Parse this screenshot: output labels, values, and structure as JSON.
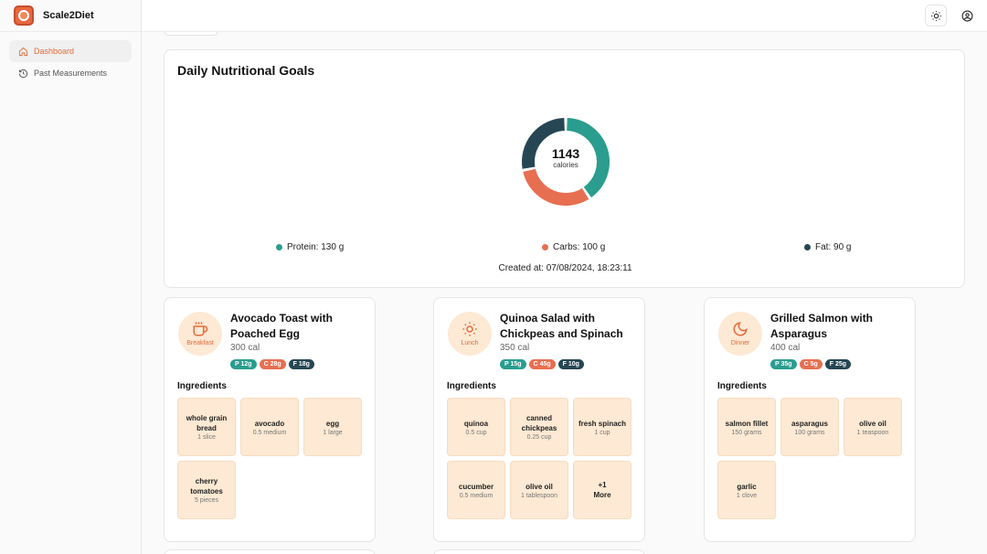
{
  "app": {
    "name": "Scale2Diet"
  },
  "sidebar": {
    "items": [
      {
        "label": "Dashboard",
        "active": true
      },
      {
        "label": "Past Measurements",
        "active": false
      }
    ]
  },
  "goals": {
    "title": "Daily Nutritional Goals",
    "calories": "1143",
    "calories_label": "calories",
    "protein": "Protein: 130 g",
    "carbs": "Carbs: 100 g",
    "fat": "Fat: 90 g",
    "created": "Created at: 07/08/2024, 18:23:11"
  },
  "chart_data": {
    "type": "pie",
    "categories": [
      "Protein",
      "Carbs",
      "Fat"
    ],
    "values": [
      130,
      100,
      90
    ],
    "colors": [
      "#2a9d8f",
      "#e76f51",
      "#264653"
    ]
  },
  "colors": {
    "accent": "#e46a3a",
    "protein": "#2a9d8f",
    "carbs": "#e76f51",
    "fat": "#264653",
    "ingredient_bg": "#fde9d4"
  },
  "ingredients_label": "Ingredients",
  "meals": [
    {
      "type": "Breakfast",
      "icon": "coffee-icon",
      "name": "Avocado Toast with Poached Egg",
      "calories": "300 cal",
      "protein": "P 12g",
      "carbs": "C 28g",
      "fat": "F 18g",
      "ingredients": [
        {
          "name": "whole grain bread",
          "qty": "1 slice"
        },
        {
          "name": "avocado",
          "qty": "0.5 medium"
        },
        {
          "name": "egg",
          "qty": "1 large"
        },
        {
          "name": "cherry tomatoes",
          "qty": "5 pieces"
        }
      ]
    },
    {
      "type": "Lunch",
      "icon": "sun-icon",
      "name": "Quinoa Salad with Chickpeas and Spinach",
      "calories": "350 cal",
      "protein": "P 15g",
      "carbs": "C 45g",
      "fat": "F 10g",
      "ingredients": [
        {
          "name": "quinoa",
          "qty": "0.5 cup"
        },
        {
          "name": "canned chickpeas",
          "qty": "0.25 cup"
        },
        {
          "name": "fresh spinach",
          "qty": "1 cup"
        },
        {
          "name": "cucumber",
          "qty": "0.5 medium"
        },
        {
          "name": "olive oil",
          "qty": "1 tablespoon"
        },
        {
          "name": "+1",
          "qty": "More"
        }
      ]
    },
    {
      "type": "Dinner",
      "icon": "moon-icon",
      "name": "Grilled Salmon with Asparagus",
      "calories": "400 cal",
      "protein": "P 35g",
      "carbs": "C 5g",
      "fat": "F 25g",
      "ingredients": [
        {
          "name": "salmon fillet",
          "qty": "150 grams"
        },
        {
          "name": "asparagus",
          "qty": "100 grams"
        },
        {
          "name": "olive oil",
          "qty": "1 teaspoon"
        },
        {
          "name": "garlic",
          "qty": "1 clove"
        }
      ]
    }
  ]
}
